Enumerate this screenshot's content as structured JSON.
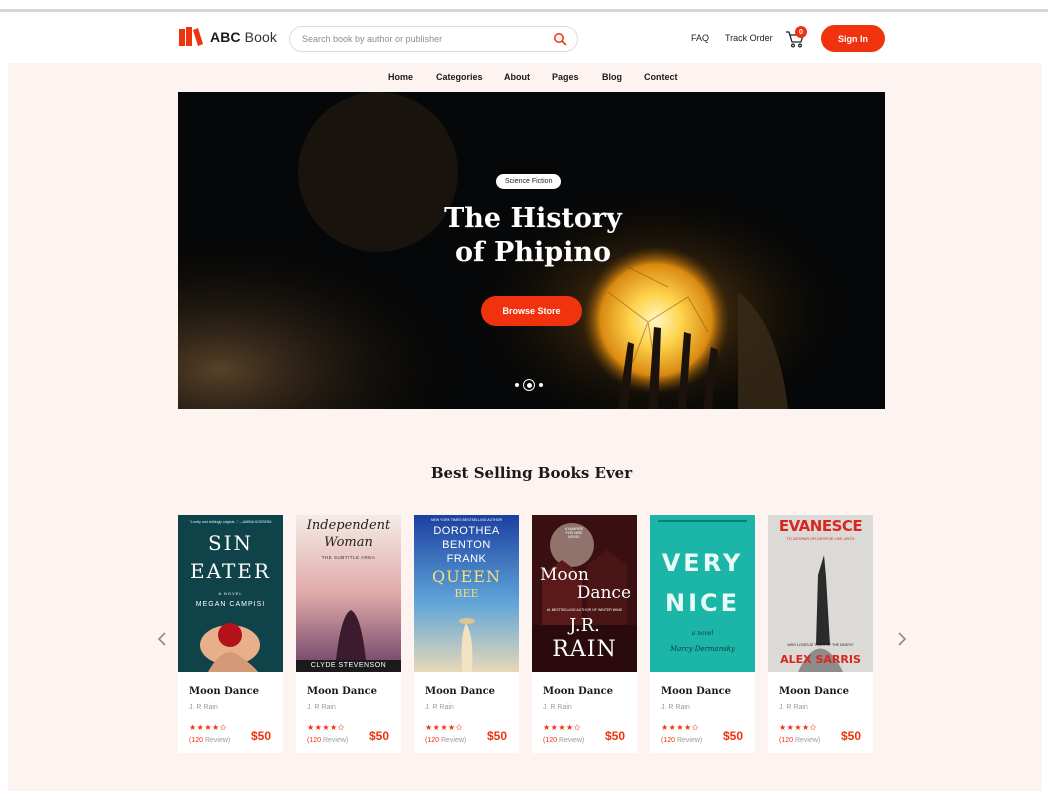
{
  "brand": {
    "name_bold": "ABC",
    "name_light": " Book"
  },
  "search": {
    "placeholder": "Search book by author or publisher"
  },
  "header_links": {
    "faq": "FAQ",
    "track": "Track Order",
    "cart_count": "0",
    "signin": "Sign In"
  },
  "nav": [
    "Home",
    "Categories",
    "About",
    "Pages",
    "Blog",
    "Contect"
  ],
  "hero": {
    "tag": "Science Fiction",
    "title_line1": "The History",
    "title_line2": "of Phipino",
    "button": "Browse Store"
  },
  "section_title": "Best Selling Books Ever",
  "colors": {
    "accent": "#f0320f",
    "page_bg": "#fdf3f1"
  },
  "icons": [
    "book-logo-icon",
    "search-icon",
    "cart-icon",
    "chevron-left-icon",
    "chevron-right-icon",
    "star-icon"
  ],
  "books": [
    {
      "title": "Moon Dance",
      "author": "J. R Rain",
      "stars": "★★★★✩",
      "reviews_count": "(120",
      "reviews_word": " Review)",
      "price": "$50",
      "cover": {
        "tagline": "\"Lovely and chillingly original...\" —AMINA HOSSEINI",
        "line1": "SIN",
        "line2": "EATER",
        "line3": "A NOVEL",
        "line4": "MEGAN CAMPISI"
      }
    },
    {
      "title": "Moon Dance",
      "author": "J. R Rain",
      "stars": "★★★★✩",
      "reviews_count": "(120",
      "reviews_word": " Review)",
      "price": "$50",
      "cover": {
        "line1": "Independent",
        "line2": "Woman",
        "line3": "THE SUBTITLE AREA",
        "line4": "CLYDE STEVENSON"
      }
    },
    {
      "title": "Moon Dance",
      "author": "J. R Rain",
      "stars": "★★★★✩",
      "reviews_count": "(120",
      "reviews_word": " Review)",
      "price": "$50",
      "cover": {
        "tagline": "NEW YORK TIMES BESTSELLING AUTHOR",
        "line1": "DOROTHEA",
        "line2": "BENTON",
        "line3": "FRANK",
        "line4": "QUEEN",
        "line5": "BEE"
      }
    },
    {
      "title": "Moon Dance",
      "author": "J. R Rain",
      "stars": "★★★★✩",
      "reviews_count": "(120",
      "reviews_word": " Review)",
      "price": "$50",
      "cover": {
        "tag": "A VAMPIRE FOR HIRE NOVEL",
        "line1": "Moon",
        "line2": "Dance",
        "line3": "#1 BESTSELLING AUTHOR OF WINTER WIND",
        "line4": "J.R.",
        "line5": "RAIN"
      }
    },
    {
      "title": "Moon Dance",
      "author": "J. R Rain",
      "stars": "★★★★✩",
      "reviews_count": "(120",
      "reviews_word": " Review)",
      "price": "$50",
      "cover": {
        "line1": "VERY",
        "line2": "NICE",
        "line3": "a novel",
        "line4": "Marcy Dermansky"
      }
    },
    {
      "title": "Moon Dance",
      "author": "J. R Rain",
      "stars": "★★★★✩",
      "reviews_count": "(120",
      "reviews_word": " Review)",
      "price": "$50",
      "cover": {
        "line1": "EVANESCE",
        "line2": "TO DESPAIR OR DESPISE LIKE UNTO",
        "line3": "WHO LOVES AT TIMES OF THE DEATH?",
        "line4": "ALEX SARRIS"
      }
    }
  ]
}
